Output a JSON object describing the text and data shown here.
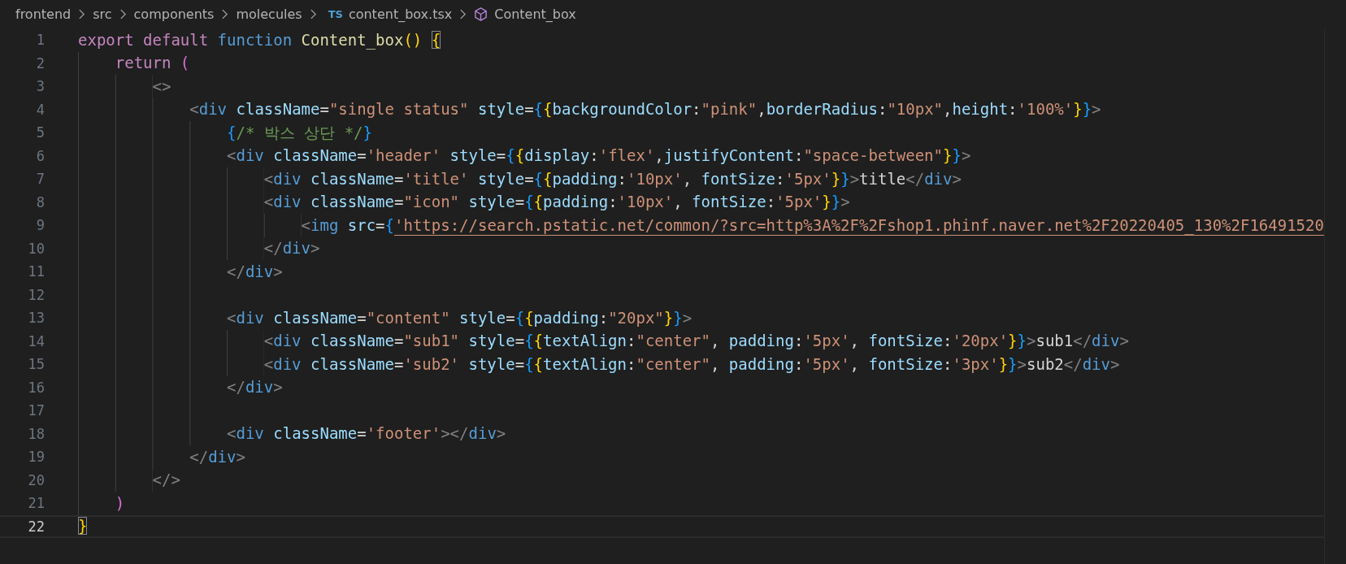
{
  "breadcrumb": [
    {
      "kind": "folder",
      "label": "frontend"
    },
    {
      "kind": "folder",
      "label": "src"
    },
    {
      "kind": "folder",
      "label": "components"
    },
    {
      "kind": "folder",
      "label": "molecules"
    },
    {
      "kind": "file",
      "badge": "TS",
      "label": "content_box.tsx"
    },
    {
      "kind": "symbol",
      "label": "Content_box"
    }
  ],
  "editor": {
    "lines": [
      {
        "number": "1",
        "active": false,
        "tokens": [
          {
            "kind": "kw",
            "t": "export"
          },
          {
            "kind": "kw",
            "t": " default"
          },
          {
            "kind": "storage",
            "t": " function"
          },
          {
            "kind": "fn",
            "t": " Content_box"
          },
          {
            "kind": "b1",
            "t": "()"
          },
          {
            "kind": "match",
            "t": " {"
          }
        ]
      },
      {
        "number": "2",
        "active": false,
        "tokens": [
          {
            "kind": "kw",
            "t": "    return"
          },
          {
            "kind": "b2",
            "t": " ("
          }
        ]
      },
      {
        "number": "3",
        "active": false,
        "tokens": [
          {
            "kind": "punct",
            "t": "        <>"
          }
        ]
      },
      {
        "number": "4",
        "active": false,
        "tokens": [
          {
            "kind": "punct",
            "t": "            <"
          },
          {
            "kind": "tag",
            "t": "div"
          },
          {
            "kind": "attr",
            "t": " className"
          },
          {
            "kind": "text",
            "t": "="
          },
          {
            "kind": "str",
            "t": "\"single status\""
          },
          {
            "kind": "attr",
            "t": " style"
          },
          {
            "kind": "text",
            "t": "="
          },
          {
            "kind": "b3",
            "t": "{"
          },
          {
            "kind": "b1",
            "t": "{"
          },
          {
            "kind": "attr",
            "t": "backgroundColor"
          },
          {
            "kind": "text",
            "t": ":"
          },
          {
            "kind": "str",
            "t": "\"pink\""
          },
          {
            "kind": "text",
            "t": ","
          },
          {
            "kind": "attr",
            "t": "borderRadius"
          },
          {
            "kind": "text",
            "t": ":"
          },
          {
            "kind": "str",
            "t": "\"10px\""
          },
          {
            "kind": "text",
            "t": ","
          },
          {
            "kind": "attr",
            "t": "height"
          },
          {
            "kind": "text",
            "t": ":"
          },
          {
            "kind": "str",
            "t": "'100%'"
          },
          {
            "kind": "b1",
            "t": "}"
          },
          {
            "kind": "b3",
            "t": "}"
          },
          {
            "kind": "punct",
            "t": ">"
          }
        ]
      },
      {
        "number": "5",
        "active": false,
        "tokens": [
          {
            "kind": "b3",
            "t": "                {"
          },
          {
            "kind": "comment",
            "t": "/* 박스 상단 */"
          },
          {
            "kind": "b3",
            "t": "}"
          }
        ]
      },
      {
        "number": "6",
        "active": false,
        "tokens": [
          {
            "kind": "punct",
            "t": "                <"
          },
          {
            "kind": "tag",
            "t": "div"
          },
          {
            "kind": "attr",
            "t": " className"
          },
          {
            "kind": "text",
            "t": "="
          },
          {
            "kind": "str",
            "t": "'header'"
          },
          {
            "kind": "attr",
            "t": " style"
          },
          {
            "kind": "text",
            "t": "="
          },
          {
            "kind": "b3",
            "t": "{"
          },
          {
            "kind": "b1",
            "t": "{"
          },
          {
            "kind": "attr",
            "t": "display"
          },
          {
            "kind": "text",
            "t": ":"
          },
          {
            "kind": "str",
            "t": "'flex'"
          },
          {
            "kind": "text",
            "t": ","
          },
          {
            "kind": "attr",
            "t": "justifyContent"
          },
          {
            "kind": "text",
            "t": ":"
          },
          {
            "kind": "str",
            "t": "\"space-between\""
          },
          {
            "kind": "b1",
            "t": "}"
          },
          {
            "kind": "b3",
            "t": "}"
          },
          {
            "kind": "punct",
            "t": ">"
          }
        ]
      },
      {
        "number": "7",
        "active": false,
        "tokens": [
          {
            "kind": "punct",
            "t": "                    <"
          },
          {
            "kind": "tag",
            "t": "div"
          },
          {
            "kind": "attr",
            "t": " className"
          },
          {
            "kind": "text",
            "t": "="
          },
          {
            "kind": "str",
            "t": "'title'"
          },
          {
            "kind": "attr",
            "t": " style"
          },
          {
            "kind": "text",
            "t": "="
          },
          {
            "kind": "b3",
            "t": "{"
          },
          {
            "kind": "b1",
            "t": "{"
          },
          {
            "kind": "attr",
            "t": "padding"
          },
          {
            "kind": "text",
            "t": ":"
          },
          {
            "kind": "str",
            "t": "'10px'"
          },
          {
            "kind": "text",
            "t": ","
          },
          {
            "kind": "attr",
            "t": " fontSize"
          },
          {
            "kind": "text",
            "t": ":"
          },
          {
            "kind": "str",
            "t": "'5px'"
          },
          {
            "kind": "b1",
            "t": "}"
          },
          {
            "kind": "b3",
            "t": "}"
          },
          {
            "kind": "punct",
            "t": ">"
          },
          {
            "kind": "text",
            "t": "title"
          },
          {
            "kind": "punct",
            "t": "</"
          },
          {
            "kind": "tag",
            "t": "div"
          },
          {
            "kind": "punct",
            "t": ">"
          }
        ]
      },
      {
        "number": "8",
        "active": false,
        "tokens": [
          {
            "kind": "punct",
            "t": "                    <"
          },
          {
            "kind": "tag",
            "t": "div"
          },
          {
            "kind": "attr",
            "t": " className"
          },
          {
            "kind": "text",
            "t": "="
          },
          {
            "kind": "str",
            "t": "\"icon\""
          },
          {
            "kind": "attr",
            "t": " style"
          },
          {
            "kind": "text",
            "t": "="
          },
          {
            "kind": "b3",
            "t": "{"
          },
          {
            "kind": "b1",
            "t": "{"
          },
          {
            "kind": "attr",
            "t": "padding"
          },
          {
            "kind": "text",
            "t": ":"
          },
          {
            "kind": "str",
            "t": "'10px'"
          },
          {
            "kind": "text",
            "t": ","
          },
          {
            "kind": "attr",
            "t": " fontSize"
          },
          {
            "kind": "text",
            "t": ":"
          },
          {
            "kind": "str",
            "t": "'5px'"
          },
          {
            "kind": "b1",
            "t": "}"
          },
          {
            "kind": "b3",
            "t": "}"
          },
          {
            "kind": "punct",
            "t": ">"
          }
        ]
      },
      {
        "number": "9",
        "active": false,
        "tokens": [
          {
            "kind": "punct",
            "t": "                        <"
          },
          {
            "kind": "tag",
            "t": "img"
          },
          {
            "kind": "attr",
            "t": " src"
          },
          {
            "kind": "text",
            "t": "="
          },
          {
            "kind": "b3",
            "t": "{"
          },
          {
            "kind": "url",
            "t": "'https://search.pstatic.net/common/?src=http%3A%2F%2Fshop1.phinf.naver.net%2F20220405_130%2F16491520"
          }
        ]
      },
      {
        "number": "10",
        "active": false,
        "tokens": [
          {
            "kind": "punct",
            "t": "                    </"
          },
          {
            "kind": "tag",
            "t": "div"
          },
          {
            "kind": "punct",
            "t": ">"
          }
        ]
      },
      {
        "number": "11",
        "active": false,
        "tokens": [
          {
            "kind": "punct",
            "t": "                </"
          },
          {
            "kind": "tag",
            "t": "div"
          },
          {
            "kind": "punct",
            "t": ">"
          }
        ]
      },
      {
        "number": "12",
        "active": false
      },
      {
        "number": "13",
        "active": false,
        "tokens": [
          {
            "kind": "punct",
            "t": "                <"
          },
          {
            "kind": "tag",
            "t": "div"
          },
          {
            "kind": "attr",
            "t": " className"
          },
          {
            "kind": "text",
            "t": "="
          },
          {
            "kind": "str",
            "t": "\"content\""
          },
          {
            "kind": "attr",
            "t": " style"
          },
          {
            "kind": "text",
            "t": "="
          },
          {
            "kind": "b3",
            "t": "{"
          },
          {
            "kind": "b1",
            "t": "{"
          },
          {
            "kind": "attr",
            "t": "padding"
          },
          {
            "kind": "text",
            "t": ":"
          },
          {
            "kind": "str",
            "t": "\"20px\""
          },
          {
            "kind": "b1",
            "t": "}"
          },
          {
            "kind": "b3",
            "t": "}"
          },
          {
            "kind": "punct",
            "t": ">"
          }
        ]
      },
      {
        "number": "14",
        "active": false,
        "tokens": [
          {
            "kind": "punct",
            "t": "                    <"
          },
          {
            "kind": "tag",
            "t": "div"
          },
          {
            "kind": "attr",
            "t": " className"
          },
          {
            "kind": "text",
            "t": "="
          },
          {
            "kind": "str",
            "t": "\"sub1\""
          },
          {
            "kind": "attr",
            "t": " style"
          },
          {
            "kind": "text",
            "t": "="
          },
          {
            "kind": "b3",
            "t": "{"
          },
          {
            "kind": "b1",
            "t": "{"
          },
          {
            "kind": "attr",
            "t": "textAlign"
          },
          {
            "kind": "text",
            "t": ":"
          },
          {
            "kind": "str",
            "t": "\"center\""
          },
          {
            "kind": "text",
            "t": ","
          },
          {
            "kind": "attr",
            "t": " padding"
          },
          {
            "kind": "text",
            "t": ":"
          },
          {
            "kind": "str",
            "t": "'5px'"
          },
          {
            "kind": "text",
            "t": ","
          },
          {
            "kind": "attr",
            "t": " fontSize"
          },
          {
            "kind": "text",
            "t": ":"
          },
          {
            "kind": "str",
            "t": "'20px'"
          },
          {
            "kind": "b1",
            "t": "}"
          },
          {
            "kind": "b3",
            "t": "}"
          },
          {
            "kind": "punct",
            "t": ">"
          },
          {
            "kind": "text",
            "t": "sub1"
          },
          {
            "kind": "punct",
            "t": "</"
          },
          {
            "kind": "tag",
            "t": "div"
          },
          {
            "kind": "punct",
            "t": ">"
          }
        ]
      },
      {
        "number": "15",
        "active": false,
        "tokens": [
          {
            "kind": "punct",
            "t": "                    <"
          },
          {
            "kind": "tag",
            "t": "div"
          },
          {
            "kind": "attr",
            "t": " className"
          },
          {
            "kind": "text",
            "t": "="
          },
          {
            "kind": "str",
            "t": "'sub2'"
          },
          {
            "kind": "attr",
            "t": " style"
          },
          {
            "kind": "text",
            "t": "="
          },
          {
            "kind": "b3",
            "t": "{"
          },
          {
            "kind": "b1",
            "t": "{"
          },
          {
            "kind": "attr",
            "t": "textAlign"
          },
          {
            "kind": "text",
            "t": ":"
          },
          {
            "kind": "str",
            "t": "\"center\""
          },
          {
            "kind": "text",
            "t": ","
          },
          {
            "kind": "attr",
            "t": " padding"
          },
          {
            "kind": "text",
            "t": ":"
          },
          {
            "kind": "str",
            "t": "'5px'"
          },
          {
            "kind": "text",
            "t": ","
          },
          {
            "kind": "attr",
            "t": " fontSize"
          },
          {
            "kind": "text",
            "t": ":"
          },
          {
            "kind": "str",
            "t": "'3px'"
          },
          {
            "kind": "b1",
            "t": "}"
          },
          {
            "kind": "b3",
            "t": "}"
          },
          {
            "kind": "punct",
            "t": ">"
          },
          {
            "kind": "text",
            "t": "sub2"
          },
          {
            "kind": "punct",
            "t": "</"
          },
          {
            "kind": "tag",
            "t": "div"
          },
          {
            "kind": "punct",
            "t": ">"
          }
        ]
      },
      {
        "number": "16",
        "active": false,
        "tokens": [
          {
            "kind": "punct",
            "t": "                </"
          },
          {
            "kind": "tag",
            "t": "div"
          },
          {
            "kind": "punct",
            "t": ">"
          }
        ]
      },
      {
        "number": "17",
        "active": false
      },
      {
        "number": "18",
        "active": false,
        "tokens": [
          {
            "kind": "punct",
            "t": "                <"
          },
          {
            "kind": "tag",
            "t": "div"
          },
          {
            "kind": "attr",
            "t": " className"
          },
          {
            "kind": "text",
            "t": "="
          },
          {
            "kind": "str",
            "t": "'footer'"
          },
          {
            "kind": "punct",
            "t": "></"
          },
          {
            "kind": "tag",
            "t": "div"
          },
          {
            "kind": "punct",
            "t": ">"
          }
        ]
      },
      {
        "number": "19",
        "active": false,
        "tokens": [
          {
            "kind": "punct",
            "t": "            </"
          },
          {
            "kind": "tag",
            "t": "div"
          },
          {
            "kind": "punct",
            "t": ">"
          }
        ]
      },
      {
        "number": "20",
        "active": false,
        "tokens": [
          {
            "kind": "punct",
            "t": "        </>"
          }
        ]
      },
      {
        "number": "21",
        "active": false,
        "tokens": [
          {
            "kind": "b2",
            "t": "    )"
          }
        ]
      },
      {
        "number": "22",
        "active": true,
        "tokens": [
          {
            "kind": "match",
            "t": "}"
          }
        ]
      }
    ]
  }
}
